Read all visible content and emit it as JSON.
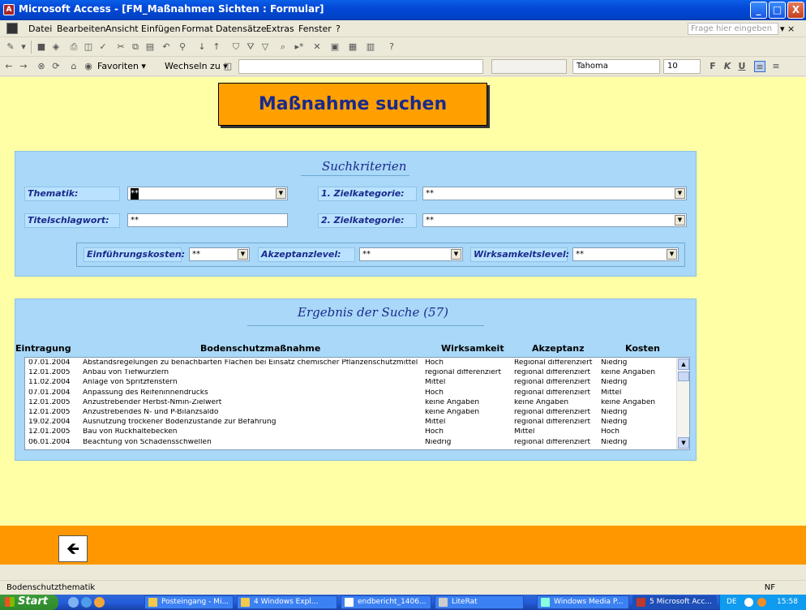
{
  "window": {
    "title": "Microsoft Access - [FM_Maßnahmen Sichten : Formular]",
    "buttons": {
      "minimize": "_",
      "maximize": "□",
      "close": "X"
    }
  },
  "menu": {
    "items": [
      "Datei",
      "Bearbeiten",
      "Ansicht",
      "Einfügen",
      "Format",
      "Datensätze",
      "Extras",
      "Fenster",
      "?"
    ],
    "help_placeholder": "Frage hier eingeben"
  },
  "toolbar2": {
    "favoriten": "Favoriten ▾",
    "wechseln": "Wechseln zu ▾",
    "font": "Tahoma",
    "size": "10",
    "bold": "F",
    "italic": "K",
    "underline": "U"
  },
  "form": {
    "title": "Maßnahme suchen",
    "criteria": {
      "heading": "Suchkriterien",
      "thematik_label": "Thematik:",
      "thematik_value": "**",
      "titelschlagwort_label": "Titelschlagwort:",
      "titelschlagwort_value": "**",
      "zielkategorie1_label": "1. Zielkategorie:",
      "zielkategorie1_value": "**",
      "zielkategorie2_label": "2. Zielkategorie:",
      "zielkategorie2_value": "**",
      "einfuehrungskosten_label": "Einführungskosten:",
      "einfuehrungskosten_value": "**",
      "akzeptanzlevel_label": "Akzeptanzlevel:",
      "akzeptanzlevel_value": "**",
      "wirksamkeitslevel_label": "Wirksamkeitslevel:",
      "wirksamkeitslevel_value": "**"
    },
    "results": {
      "heading": "Ergebnis der Suche  (57)",
      "columns": {
        "eintragung": "Eintragung",
        "massnahme": "Bodenschutzmaßnahme",
        "wirksamkeit": "Wirksamkeit",
        "akzeptanz": "Akzeptanz",
        "kosten": "Kosten"
      },
      "rows": [
        {
          "date": "07.01.2004",
          "name": "Abstandsregelungen zu benachbarten Flächen bei Einsatz chemischer Pflanzenschutzmittel",
          "wirk": "Hoch",
          "akz": "Regional differenziert",
          "kost": "Niedrig"
        },
        {
          "date": "12.01.2005",
          "name": "Anbau von Tiefwurzlern",
          "wirk": "regional differenziert",
          "akz": "regional differenziert",
          "kost": "keine Angaben"
        },
        {
          "date": "11.02.2004",
          "name": "Anlage von Spritzfenstern",
          "wirk": "Mittel",
          "akz": "regional differenziert",
          "kost": "Niedrig"
        },
        {
          "date": "07.01.2004",
          "name": "Anpassung des Reifeninnendrucks",
          "wirk": "Hoch",
          "akz": "regional differenziert",
          "kost": "Mittel"
        },
        {
          "date": "12.01.2005",
          "name": "Anzustrebender Herbst-Nmin-Zielwert",
          "wirk": "keine Angaben",
          "akz": "keine Angaben",
          "kost": "keine Angaben"
        },
        {
          "date": "12.01.2005",
          "name": "Anzustrebendes N- und P-Bilanzsaldo",
          "wirk": "keine Angaben",
          "akz": "regional differenziert",
          "kost": "Niedrig"
        },
        {
          "date": "19.02.2004",
          "name": "Ausnutzung trockener Bodenzustände zur Befahrung",
          "wirk": "Mittel",
          "akz": "regional differenziert",
          "kost": "Niedrig"
        },
        {
          "date": "12.01.2005",
          "name": "Bau von Rückhaltebecken",
          "wirk": "Hoch",
          "akz": "Mittel",
          "kost": "Hoch"
        },
        {
          "date": "06.01.2004",
          "name": "Beachtung von Schadensschwellen",
          "wirk": "Niedrig",
          "akz": "regional differenziert",
          "kost": "Niedrig"
        }
      ]
    },
    "back_icon": "arrow-left-icon"
  },
  "status": {
    "text": "Bodenschutzthematik",
    "indicator": "NF"
  },
  "taskbar": {
    "start": "Start",
    "tasks": [
      "Posteingang - Mi...",
      "4 Windows Expl...",
      "endbericht_1406...",
      "LiteRat",
      "Windows Media P...",
      "5 Microsoft Acc..."
    ],
    "lang": "DE",
    "clock": "15:58"
  },
  "colors": {
    "form_bg": "#FFFFA6",
    "panel_bg": "#A9D8F8",
    "accent_orange": "#FF9800",
    "heading_blue": "#1A2A8C"
  }
}
